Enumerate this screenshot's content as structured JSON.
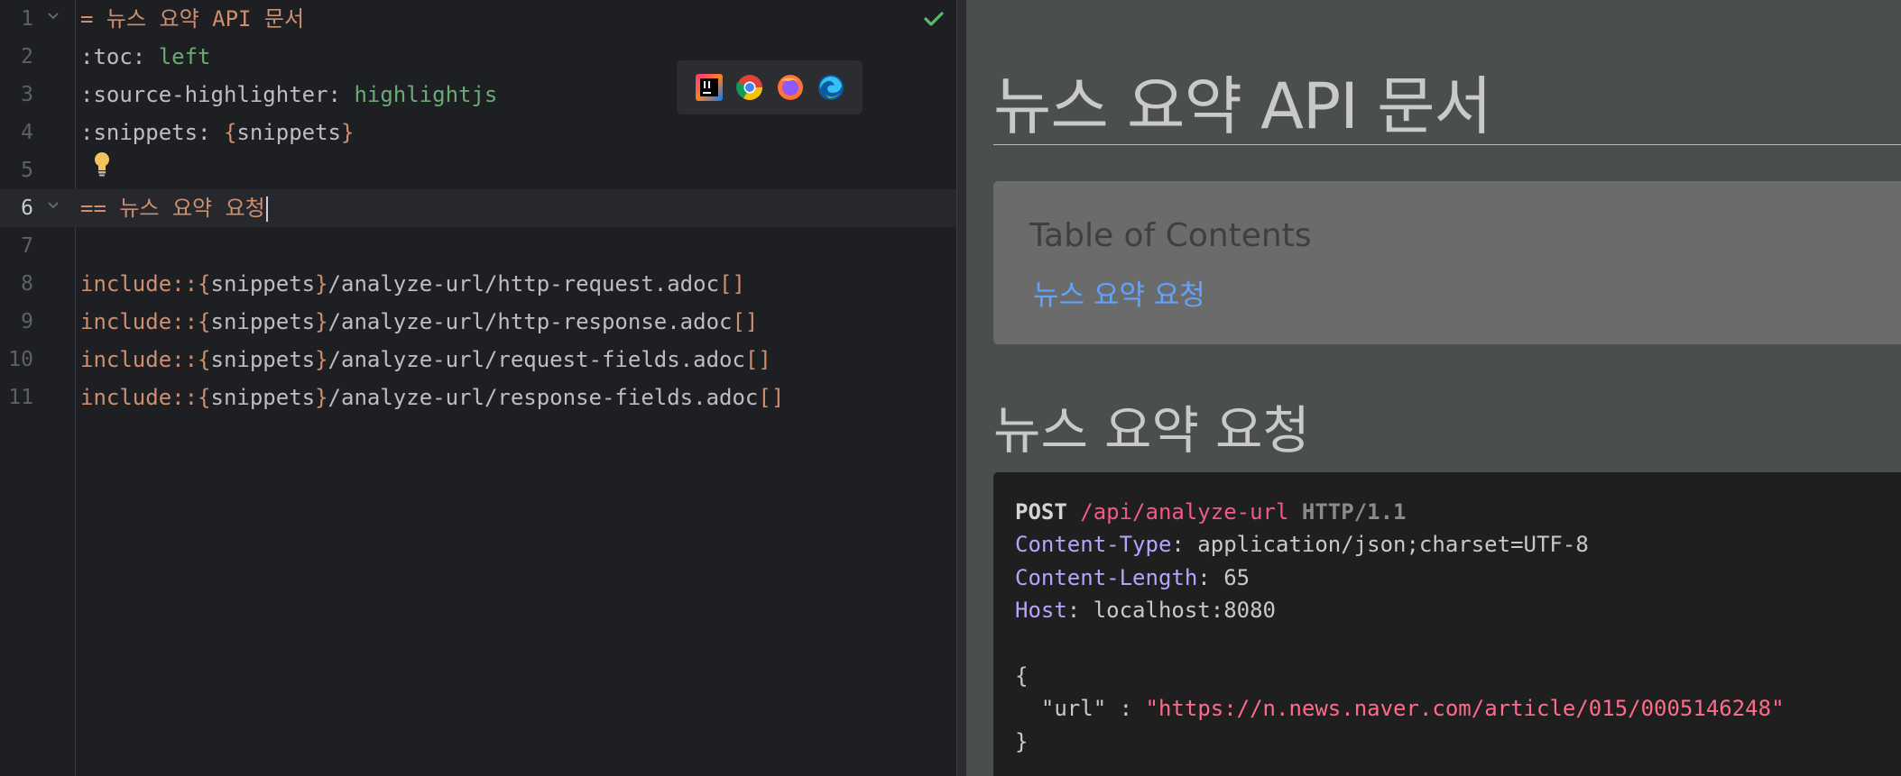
{
  "editor": {
    "lines": [
      {
        "num": "1",
        "tokens": [
          {
            "t": "= 뉴스 요약 API 문서",
            "c": "orange"
          }
        ]
      },
      {
        "num": "2",
        "tokens": [
          {
            "t": ":toc: ",
            "c": "plain"
          },
          {
            "t": "left",
            "c": "green"
          }
        ]
      },
      {
        "num": "3",
        "tokens": [
          {
            "t": ":source-highlighter: ",
            "c": "plain"
          },
          {
            "t": "highlightjs",
            "c": "green"
          }
        ]
      },
      {
        "num": "4",
        "tokens": [
          {
            "t": ":snippets: ",
            "c": "plain"
          },
          {
            "t": "{",
            "c": "orange"
          },
          {
            "t": "snippets",
            "c": "plain"
          },
          {
            "t": "}",
            "c": "orange"
          }
        ]
      },
      {
        "num": "5",
        "tokens": []
      },
      {
        "num": "6",
        "tokens": [
          {
            "t": "== 뉴스 요약 요청",
            "c": "orange"
          }
        ]
      },
      {
        "num": "7",
        "tokens": []
      },
      {
        "num": "8",
        "tokens": [
          {
            "t": "include::",
            "c": "orange"
          },
          {
            "t": "{",
            "c": "orange"
          },
          {
            "t": "snippets",
            "c": "plain"
          },
          {
            "t": "}",
            "c": "orange"
          },
          {
            "t": "/analyze-url/http-request.adoc",
            "c": "plain"
          },
          {
            "t": "[]",
            "c": "orange"
          }
        ]
      },
      {
        "num": "9",
        "tokens": [
          {
            "t": "include::",
            "c": "orange"
          },
          {
            "t": "{",
            "c": "orange"
          },
          {
            "t": "snippets",
            "c": "plain"
          },
          {
            "t": "}",
            "c": "orange"
          },
          {
            "t": "/analyze-url/http-response.adoc",
            "c": "plain"
          },
          {
            "t": "[]",
            "c": "orange"
          }
        ]
      },
      {
        "num": "10",
        "tokens": [
          {
            "t": "include::",
            "c": "orange"
          },
          {
            "t": "{",
            "c": "orange"
          },
          {
            "t": "snippets",
            "c": "plain"
          },
          {
            "t": "}",
            "c": "orange"
          },
          {
            "t": "/analyze-url/request-fields.adoc",
            "c": "plain"
          },
          {
            "t": "[]",
            "c": "orange"
          }
        ]
      },
      {
        "num": "11",
        "tokens": [
          {
            "t": "include::",
            "c": "orange"
          },
          {
            "t": "{",
            "c": "orange"
          },
          {
            "t": "snippets",
            "c": "plain"
          },
          {
            "t": "}",
            "c": "orange"
          },
          {
            "t": "/analyze-url/response-fields.adoc",
            "c": "plain"
          },
          {
            "t": "[]",
            "c": "orange"
          }
        ]
      }
    ],
    "current_line": "6",
    "fold_lines": [
      "1",
      "6"
    ],
    "browser_icons": [
      "intellij-icon",
      "chrome-icon",
      "firefox-icon",
      "edge-icon"
    ]
  },
  "preview": {
    "title": "뉴스 요약 API 문서",
    "toc_title": "Table of Contents",
    "toc_items": [
      "뉴스 요약 요청"
    ],
    "section_title": "뉴스 요약 요청",
    "http_request": {
      "method": "POST",
      "path": "/api/analyze-url",
      "protocol": "HTTP/1.1",
      "headers": [
        {
          "key": "Content-Type",
          "value": "application/json;charset=UTF-8"
        },
        {
          "key": "Content-Length",
          "value": "65"
        },
        {
          "key": "Host",
          "value": "localhost:8080"
        }
      ],
      "body_open": "{",
      "body_key": "\"url\"",
      "body_sep": " : ",
      "body_value": "\"https://n.news.naver.com/article/015/0005146248\"",
      "body_close": "}"
    }
  },
  "colors": {
    "editor_bg": "#1e1f22",
    "keyword_orange": "#cf8e6d",
    "value_green": "#6aab73",
    "preview_bg": "#4b4e4f",
    "toc_link": "#5fa3ff"
  }
}
